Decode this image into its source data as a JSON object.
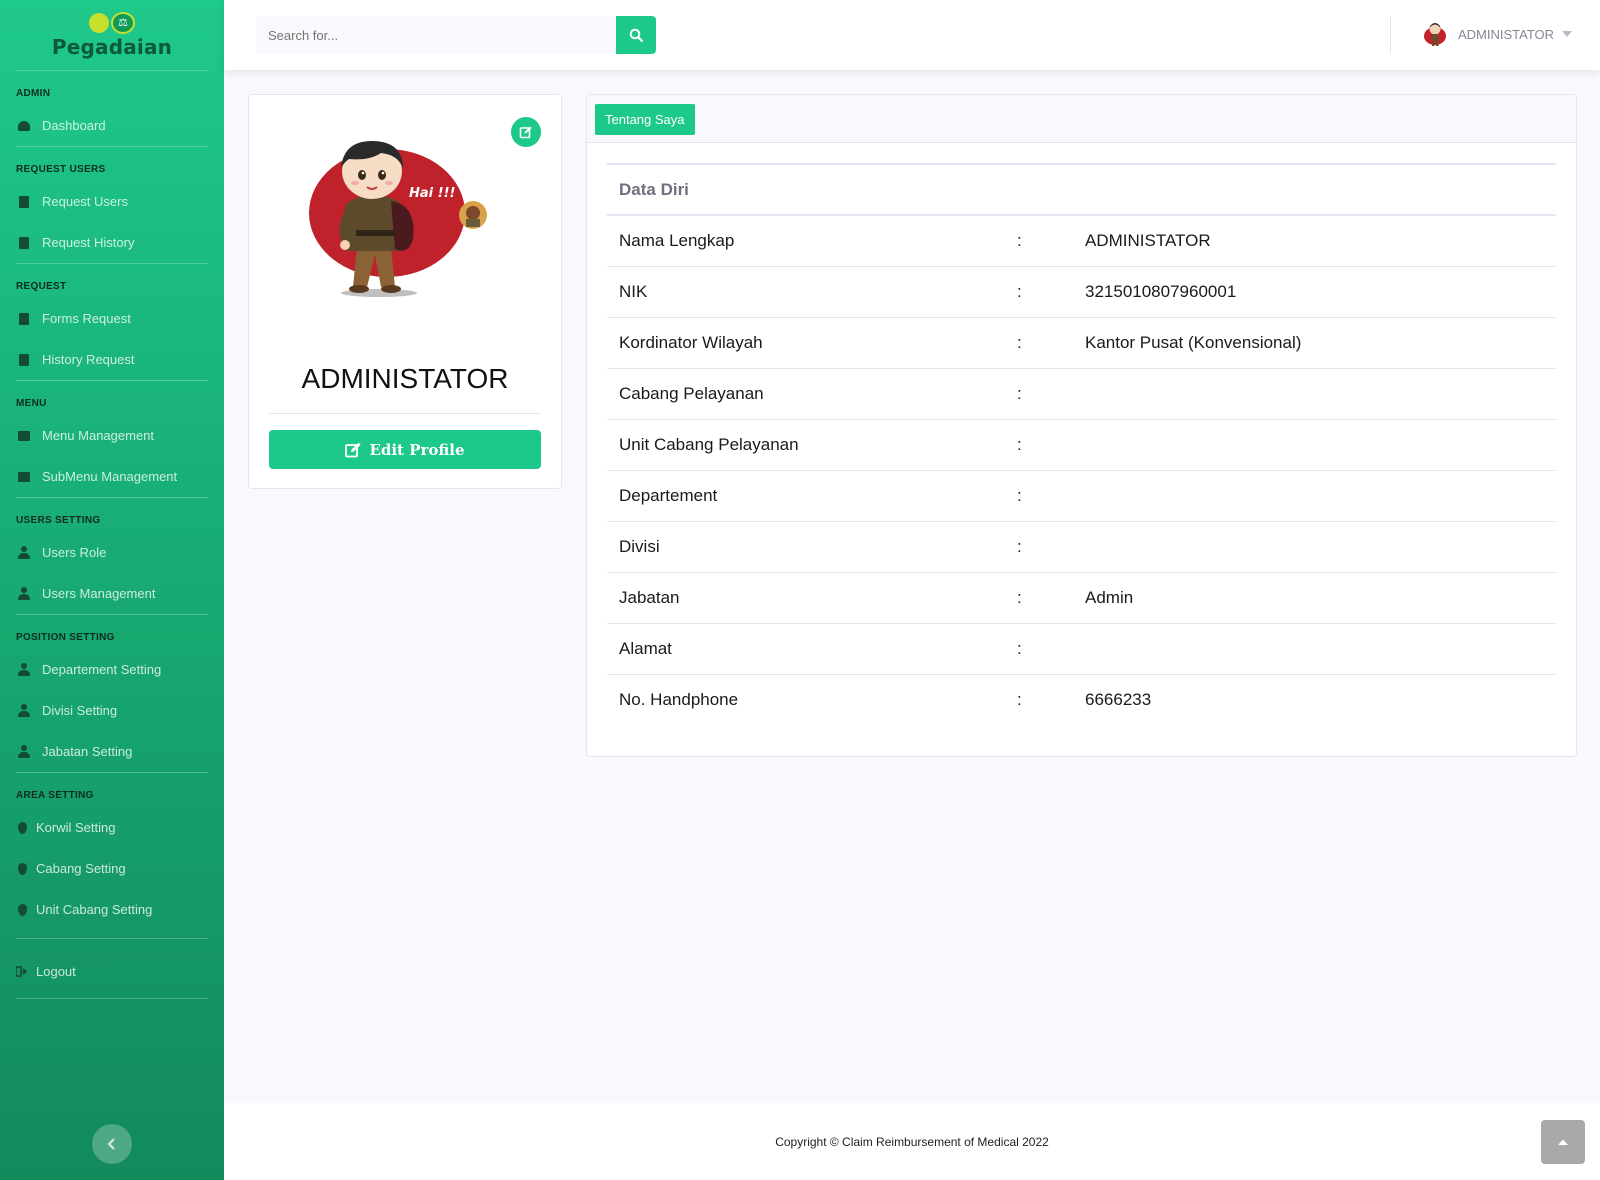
{
  "brand": {
    "name": "Pegadaian"
  },
  "sidebar": {
    "sections": [
      {
        "heading": "ADMIN",
        "items": [
          {
            "label": "Dashboard",
            "icon": "dashboard-icon"
          }
        ]
      },
      {
        "heading": "REQUEST USERS",
        "items": [
          {
            "label": "Request Users",
            "icon": "book-icon"
          },
          {
            "label": "Request History",
            "icon": "book-icon"
          }
        ]
      },
      {
        "heading": "REQUEST",
        "items": [
          {
            "label": "Forms Request",
            "icon": "book-icon"
          },
          {
            "label": "History Request",
            "icon": "book-icon"
          }
        ]
      },
      {
        "heading": "MENU",
        "items": [
          {
            "label": "Menu Management",
            "icon": "folder-icon"
          },
          {
            "label": "SubMenu Management",
            "icon": "folder-open-icon"
          }
        ]
      },
      {
        "heading": "USERS SETTING",
        "items": [
          {
            "label": "Users Role",
            "icon": "user-tie-icon"
          },
          {
            "label": "Users Management",
            "icon": "user-tie-icon"
          }
        ]
      },
      {
        "heading": "POSITION SETTING",
        "items": [
          {
            "label": "Departement Setting",
            "icon": "user-icon"
          },
          {
            "label": "Divisi Setting",
            "icon": "user-icon"
          },
          {
            "label": "Jabatan Setting",
            "icon": "user-icon"
          }
        ]
      },
      {
        "heading": "AREA SETTING",
        "items": [
          {
            "label": "Korwil Setting",
            "icon": "map-marker-icon"
          },
          {
            "label": "Cabang Setting",
            "icon": "map-marker-icon"
          },
          {
            "label": "Unit Cabang Setting",
            "icon": "map-marker-icon"
          }
        ]
      }
    ],
    "logout": "Logout",
    "toggle_icon": "chevron-left-icon"
  },
  "topbar": {
    "search_placeholder": "Search for...",
    "user_name": "ADMINISTATOR"
  },
  "profile": {
    "bubble_text": "Hai !!!",
    "name": "ADMINISTATOR",
    "edit_button": "Edit Profile"
  },
  "about": {
    "tab_label": "Tentang Saya",
    "section_title": "Data Diri",
    "rows": [
      {
        "label": "Nama Lengkap",
        "value": "ADMINISTATOR"
      },
      {
        "label": "NIK",
        "value": "3215010807960001"
      },
      {
        "label": "Kordinator Wilayah",
        "value": "Kantor Pusat (Konvensional)"
      },
      {
        "label": "Cabang Pelayanan",
        "value": ""
      },
      {
        "label": "Unit Cabang Pelayanan",
        "value": ""
      },
      {
        "label": "Departement",
        "value": ""
      },
      {
        "label": "Divisi",
        "value": ""
      },
      {
        "label": "Jabatan",
        "value": "Admin"
      },
      {
        "label": "Alamat",
        "value": ""
      },
      {
        "label": "No. Handphone",
        "value": "6666233"
      }
    ],
    "colon": ":"
  },
  "footer": {
    "copyright": "Copyright © Claim Reimbursement of Medical 2022"
  },
  "colors": {
    "primary": "#1cc88a",
    "sidebar_top": "#1fc98b",
    "sidebar_bottom": "#138a5c"
  }
}
